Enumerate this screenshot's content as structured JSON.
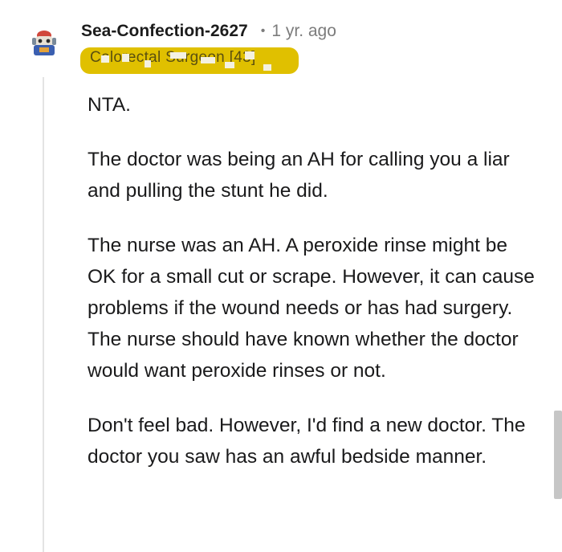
{
  "comment": {
    "username": "Sea-Confection-2627",
    "separator": "•",
    "age": "1 yr. ago",
    "flair": "Colorectal Surgeon [43]",
    "paragraphs": [
      "NTA.",
      "The doctor was being an AH for calling you a liar and pulling the stunt he did.",
      "The nurse was an AH. A peroxide rinse might be OK for a small cut or scrape. However, it can cause problems if the wound needs or has had surgery. The nurse should have known whether the doctor would want peroxide rinses or not.",
      "Don't feel bad. However, I'd find a new doctor. The doctor you saw has an awful bedside manner."
    ]
  },
  "colors": {
    "flair_background": "#e0c000",
    "thread_line": "#e3e3e3",
    "meta_text": "#7c7c7c"
  },
  "icons": {
    "avatar": "snoo-avatar-icon"
  }
}
